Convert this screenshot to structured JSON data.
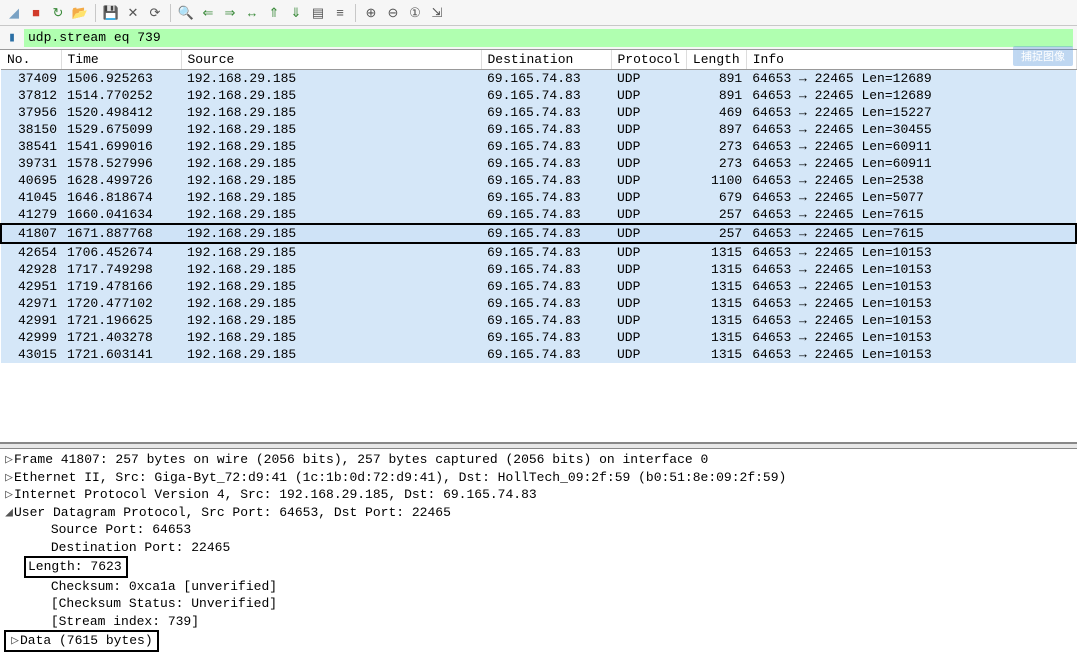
{
  "toolbar_icons": [
    "shark",
    "stop",
    "restart",
    "open",
    "save",
    "close",
    "reload",
    "find",
    "prev",
    "next",
    "goto",
    "up",
    "down",
    "autoscroll",
    "coloring",
    "zoomin",
    "zoomout",
    "zoomreset",
    "resize"
  ],
  "filter": {
    "text": "udp.stream eq 739"
  },
  "columns": [
    "No.",
    "Time",
    "Source",
    "Destination",
    "Protocol",
    "Length",
    "Info"
  ],
  "packets": [
    {
      "no": "37409",
      "time": "1506.925263",
      "src": "192.168.29.185",
      "dst": "69.165.74.83",
      "proto": "UDP",
      "len": "891",
      "info": "64653 → 22465 Len=12689"
    },
    {
      "no": "37812",
      "time": "1514.770252",
      "src": "192.168.29.185",
      "dst": "69.165.74.83",
      "proto": "UDP",
      "len": "891",
      "info": "64653 → 22465 Len=12689"
    },
    {
      "no": "37956",
      "time": "1520.498412",
      "src": "192.168.29.185",
      "dst": "69.165.74.83",
      "proto": "UDP",
      "len": "469",
      "info": "64653 → 22465 Len=15227"
    },
    {
      "no": "38150",
      "time": "1529.675099",
      "src": "192.168.29.185",
      "dst": "69.165.74.83",
      "proto": "UDP",
      "len": "897",
      "info": "64653 → 22465 Len=30455"
    },
    {
      "no": "38541",
      "time": "1541.699016",
      "src": "192.168.29.185",
      "dst": "69.165.74.83",
      "proto": "UDP",
      "len": "273",
      "info": "64653 → 22465 Len=60911"
    },
    {
      "no": "39731",
      "time": "1578.527996",
      "src": "192.168.29.185",
      "dst": "69.165.74.83",
      "proto": "UDP",
      "len": "273",
      "info": "64653 → 22465 Len=60911"
    },
    {
      "no": "40695",
      "time": "1628.499726",
      "src": "192.168.29.185",
      "dst": "69.165.74.83",
      "proto": "UDP",
      "len": "1100",
      "info": "64653 → 22465 Len=2538"
    },
    {
      "no": "41045",
      "time": "1646.818674",
      "src": "192.168.29.185",
      "dst": "69.165.74.83",
      "proto": "UDP",
      "len": "679",
      "info": "64653 → 22465 Len=5077"
    },
    {
      "no": "41279",
      "time": "1660.041634",
      "src": "192.168.29.185",
      "dst": "69.165.74.83",
      "proto": "UDP",
      "len": "257",
      "info": "64653 → 22465 Len=7615"
    },
    {
      "no": "41807",
      "time": "1671.887768",
      "src": "192.168.29.185",
      "dst": "69.165.74.83",
      "proto": "UDP",
      "len": "257",
      "info": "64653 → 22465 Len=7615",
      "boxed": true,
      "selected": true
    },
    {
      "no": "42654",
      "time": "1706.452674",
      "src": "192.168.29.185",
      "dst": "69.165.74.83",
      "proto": "UDP",
      "len": "1315",
      "info": "64653 → 22465 Len=10153"
    },
    {
      "no": "42928",
      "time": "1717.749298",
      "src": "192.168.29.185",
      "dst": "69.165.74.83",
      "proto": "UDP",
      "len": "1315",
      "info": "64653 → 22465 Len=10153"
    },
    {
      "no": "42951",
      "time": "1719.478166",
      "src": "192.168.29.185",
      "dst": "69.165.74.83",
      "proto": "UDP",
      "len": "1315",
      "info": "64653 → 22465 Len=10153"
    },
    {
      "no": "42971",
      "time": "1720.477102",
      "src": "192.168.29.185",
      "dst": "69.165.74.83",
      "proto": "UDP",
      "len": "1315",
      "info": "64653 → 22465 Len=10153"
    },
    {
      "no": "42991",
      "time": "1721.196625",
      "src": "192.168.29.185",
      "dst": "69.165.74.83",
      "proto": "UDP",
      "len": "1315",
      "info": "64653 → 22465 Len=10153"
    },
    {
      "no": "42999",
      "time": "1721.403278",
      "src": "192.168.29.185",
      "dst": "69.165.74.83",
      "proto": "UDP",
      "len": "1315",
      "info": "64653 → 22465 Len=10153"
    },
    {
      "no": "43015",
      "time": "1721.603141",
      "src": "192.168.29.185",
      "dst": "69.165.74.83",
      "proto": "UDP",
      "len": "1315",
      "info": "64653 → 22465 Len=10153"
    }
  ],
  "details": {
    "frame": "Frame 41807: 257 bytes on wire (2056 bits), 257 bytes captured (2056 bits) on interface 0",
    "eth": "Ethernet II, Src: Giga-Byt_72:d9:41 (1c:1b:0d:72:d9:41), Dst: HollTech_09:2f:59 (b0:51:8e:09:2f:59)",
    "ip": "Internet Protocol Version 4, Src: 192.168.29.185, Dst: 69.165.74.83",
    "udp": "User Datagram Protocol, Src Port: 64653, Dst Port: 22465",
    "src_port": "Source Port: 64653",
    "dst_port": "Destination Port: 22465",
    "length": "Length: 7623",
    "checksum": "Checksum: 0xca1a [unverified]",
    "chk_stat": "[Checksum Status: Unverified]",
    "stream": "[Stream index: 739]",
    "data": "Data (7615 bytes)"
  },
  "overlay_label": "捕捉图像"
}
